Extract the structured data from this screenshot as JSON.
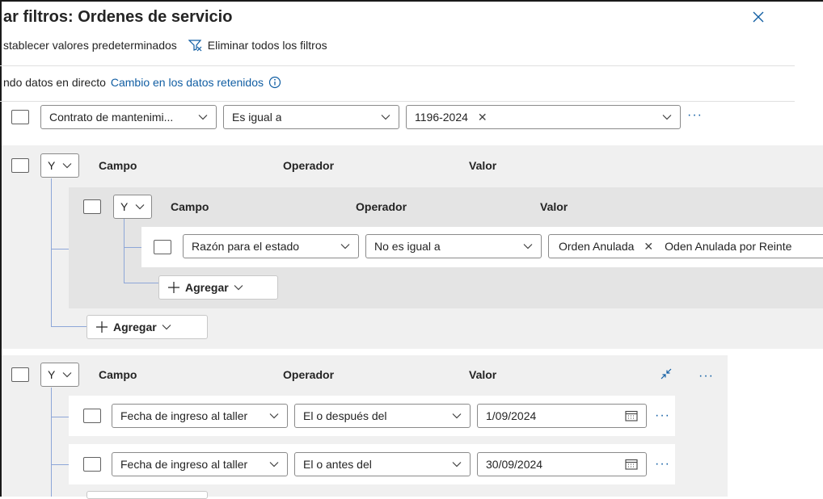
{
  "header": {
    "title": "ar filtros: Ordenes de servicio"
  },
  "toolbar": {
    "reset_label": "stablecer valores predeterminados",
    "clear_label": "Eliminar todos los filtros"
  },
  "info": {
    "text": "ndo datos en directo",
    "link": "Cambio en los datos retenidos"
  },
  "row1": {
    "field": "Contrato de mantenimi...",
    "operator": "Es igual a",
    "value_tag": "1196-2024"
  },
  "group1": {
    "operator": "Y",
    "col_field": "Campo",
    "col_operator": "Operador",
    "col_value": "Valor",
    "add_label": "Agregar",
    "subgroup": {
      "operator": "Y",
      "col_field": "Campo",
      "col_operator": "Operador",
      "col_value": "Valor",
      "add_label": "Agregar",
      "row": {
        "field": "Razón para el estado",
        "operator": "No es igual a",
        "tags": [
          "Orden Anulada",
          "Oden Anulada por Reinte"
        ]
      }
    }
  },
  "group2": {
    "operator": "Y",
    "col_field": "Campo",
    "col_operator": "Operador",
    "col_value": "Valor",
    "rows": [
      {
        "field": "Fecha de ingreso al taller",
        "operator": "El o después del",
        "date": "1/09/2024"
      },
      {
        "field": "Fecha de ingreso al taller",
        "operator": "El o antes del",
        "date": "30/09/2024"
      }
    ]
  },
  "colors": {
    "link": "#115ea3",
    "tree_line": "#8da6d8",
    "group_bg": "#f0f0f0",
    "subgroup_bg": "#e4e4e4"
  },
  "icons": [
    "close-icon",
    "filter-clear-icon",
    "info-icon",
    "chevron-down-icon",
    "plus-icon",
    "collapse-icon",
    "calendar-icon",
    "more-icon"
  ]
}
